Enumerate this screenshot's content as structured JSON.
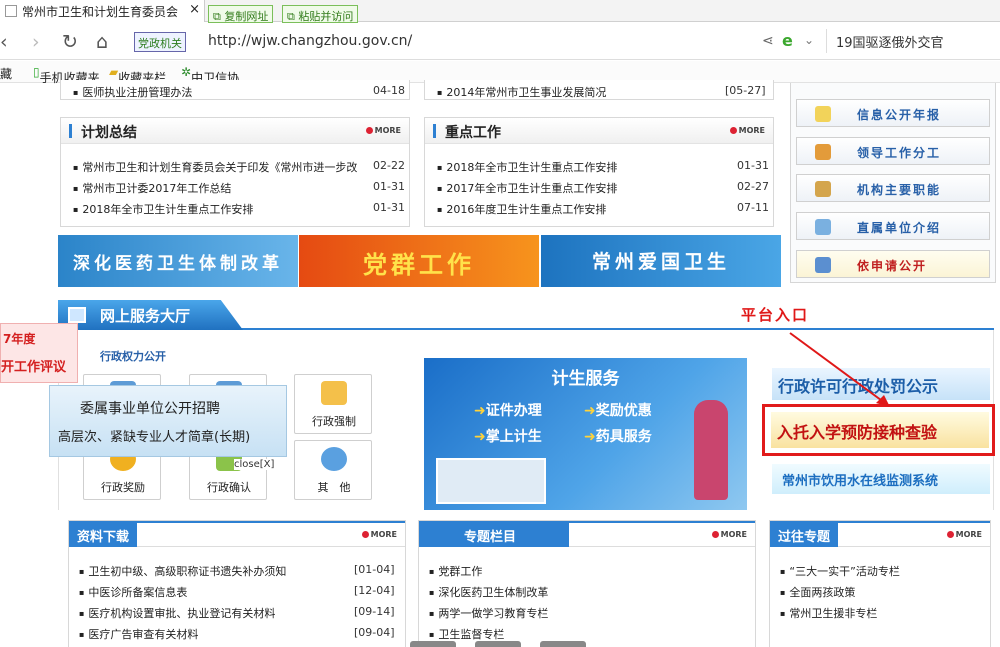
{
  "browser": {
    "tab_title": "常州市卫生和计划生育委员会",
    "tab_close": "×",
    "copy_url_label": "复制网址",
    "paste_visit_label": "粘贴并访问",
    "gov_badge": "党政机关",
    "url": "http://wjw.changzhou.gov.cn/",
    "search_text": "19国驱逐俄外交官",
    "bookmarks": [
      "藏",
      "手机收藏夹",
      "收藏夹栏",
      "中卫信协"
    ]
  },
  "top_cut": {
    "left_item": "医师执业注册管理办法",
    "left_date": "04-18",
    "right_item": "2014年常州市卫生事业发展简况",
    "right_date": "[05-27]"
  },
  "plan": {
    "title": "计划总结",
    "more": "MORE",
    "items": [
      {
        "text": "常州市卫生和计划生育委员会关于印发《常州市进一步改",
        "date": "02-22"
      },
      {
        "text": "常州市卫计委2017年工作总结",
        "date": "01-31"
      },
      {
        "text": "2018年全市卫生计生重点工作安排",
        "date": "01-31"
      }
    ]
  },
  "key": {
    "title": "重点工作",
    "more": "MORE",
    "items": [
      {
        "text": "2018年全市卫生计生重点工作安排",
        "date": "01-31"
      },
      {
        "text": "2017年全市卫生计生重点工作安排",
        "date": "02-27"
      },
      {
        "text": "2016年度卫生计生重点工作安排",
        "date": "07-11"
      }
    ]
  },
  "banners": [
    "深化医药卫生体制改革",
    "党群工作",
    "常州爱国卫生"
  ],
  "right_menu": [
    "信息公开年报",
    "领导工作分工",
    "机构主要职能",
    "直属单位介绍",
    "依申请公开"
  ],
  "service": {
    "title": "网上服务大厅",
    "annotation": "平台入口",
    "admin_power": "行政权力公开",
    "buttons": [
      "行政强制",
      "行政奖励",
      "行政确认",
      "其　他"
    ],
    "close_text": "close[X]",
    "side_float": [
      "7年度",
      "开工作评议"
    ],
    "recruit_line1": "委属事业单位公开招聘",
    "recruit_line2": "高层次、紧缺专业人才简章(长期)",
    "center_title": "计生服务",
    "center_items": [
      "证件办理",
      "奖励优惠",
      "掌上计生",
      "药具服务"
    ],
    "links": [
      "行政许可行政处罚公示",
      "入托入学预防接种查验",
      "常州市饮用水在线监测系统"
    ]
  },
  "downloads": {
    "title": "资料下载",
    "more": "MORE",
    "items": [
      {
        "text": "卫生初中级、高级职称证书遗失补办须知",
        "date": "[01-04]"
      },
      {
        "text": "中医诊所备案信息表",
        "date": "[12-04]"
      },
      {
        "text": "医疗机构设置审批、执业登记有关材料",
        "date": "[09-14]"
      },
      {
        "text": "医疗广告审查有关材料",
        "date": "[09-04]"
      }
    ]
  },
  "topics": {
    "title": "专题栏目",
    "more": "MORE",
    "items": [
      "党群工作",
      "深化医药卫生体制改革",
      "两学一做学习教育专栏",
      "卫生监督专栏"
    ]
  },
  "past": {
    "title": "过往专题",
    "more": "MORE",
    "items": [
      "“三大一实干”活动专栏",
      "全面两孩政策",
      "常州卫生援非专栏"
    ]
  },
  "colors": {
    "accent": "#2d80d2",
    "red": "#d42020",
    "link_blue": "#2860a8"
  }
}
